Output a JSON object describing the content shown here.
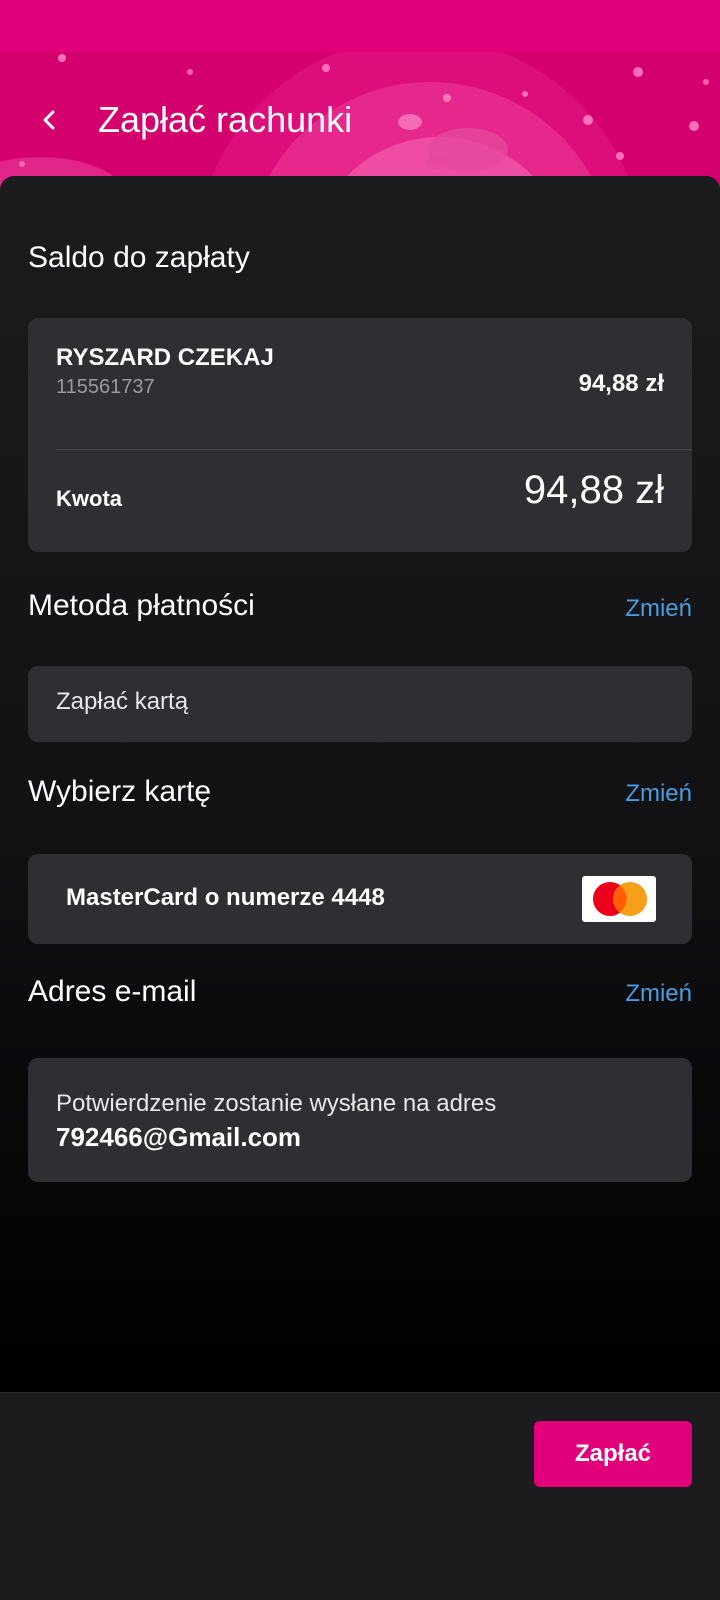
{
  "header": {
    "title": "Zapłać rachunki",
    "back_icon": "back-arrow-icon",
    "accent_color": "#e2007a"
  },
  "balance": {
    "section_title": "Saldo do zapłaty",
    "account_name": "RYSZARD CZEKAJ",
    "account_number": "115561737",
    "account_amount": "94,88 zł",
    "total_label": "Kwota",
    "total_amount": "94,88 zł"
  },
  "payment_method": {
    "section_title": "Metoda płatności",
    "change_label": "Zmień",
    "value": "Zapłać kartą"
  },
  "card_select": {
    "section_title": "Wybierz kartę",
    "change_label": "Zmień",
    "value": "MasterCard o numerze 4448",
    "logo_icon": "mastercard-logo-icon"
  },
  "email": {
    "section_title": "Adres e-mail",
    "change_label": "Zmień",
    "info_text": "Potwierdzenie zostanie wysłane na adres",
    "address": "792466@Gmail.com"
  },
  "footer": {
    "pay_label": "Zapłać"
  },
  "colors": {
    "link": "#4a9be0",
    "card_bg": "#2e2e33",
    "header_bg": "#d4006e"
  }
}
